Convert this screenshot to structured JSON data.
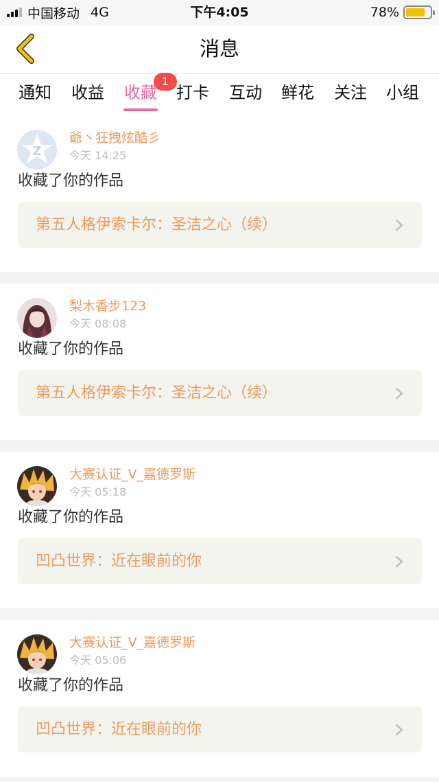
{
  "status_bar": {
    "carrier": "中国移动",
    "network": "4G",
    "time": "下午4:05",
    "battery": "78%",
    "battery_level": 0.78
  },
  "header": {
    "title": "消息"
  },
  "tabs": [
    {
      "label": "通知"
    },
    {
      "label": "收益"
    },
    {
      "label": "收藏",
      "badge": "1",
      "active": true
    },
    {
      "label": "打卡"
    },
    {
      "label": "互动"
    },
    {
      "label": "鲜花"
    },
    {
      "label": "关注"
    },
    {
      "label": "小组"
    }
  ],
  "messages": [
    {
      "username": "爺丶狂拽炫酷彡",
      "time": "今天 14:25",
      "action": "收藏了你的作品",
      "work_title": "第五人格伊索卡尔：圣洁之心（续）"
    },
    {
      "username": "梨木香步123",
      "time": "今天 08:08",
      "action": "收藏了你的作品",
      "work_title": "第五人格伊索卡尔：圣洁之心（续）"
    },
    {
      "username": "大赛认证_V_嘉德罗斯",
      "time": "今天 05:18",
      "action": "收藏了你的作品",
      "work_title": "凹凸世界：近在眼前的你"
    },
    {
      "username": "大赛认证_V_嘉德罗斯",
      "time": "今天 05:06",
      "action": "收藏了你的作品",
      "work_title": "凹凸世界：近在眼前的你"
    }
  ],
  "colors": {
    "accent": "#e7689f",
    "username": "#ec9a5e",
    "badge": "#f04a4a",
    "back_arrow": "#f2c200"
  }
}
